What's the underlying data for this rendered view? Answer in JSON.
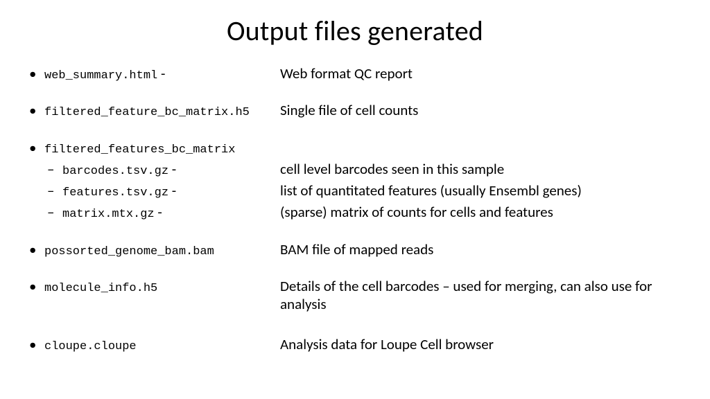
{
  "title": "Output files generated",
  "items": {
    "web_summary": {
      "file": "web_summary.html",
      "dash": "-",
      "desc": "Web format QC report"
    },
    "ffbm_h5": {
      "file": "filtered_feature_bc_matrix.h5",
      "desc": "Single file of cell counts"
    },
    "ffbm_dir": {
      "file": "filtered_features_bc_matrix"
    },
    "barcodes": {
      "file": "barcodes.tsv.gz",
      "dash": "-",
      "desc": "cell level barcodes seen in this sample"
    },
    "features": {
      "file": "features.tsv.gz",
      "dash": "-",
      "desc": "list of quantitated features (usually Ensembl genes)"
    },
    "matrix": {
      "file": "matrix.mtx.gz",
      "dash": "-",
      "desc": "(sparse) matrix of counts for cells and features"
    },
    "bam": {
      "file": "possorted_genome_bam.bam",
      "desc": "BAM file of mapped reads"
    },
    "molinfo": {
      "file": "molecule_info.h5",
      "desc": "Details of the cell barcodes – used for merging, can also use for analysis"
    },
    "cloupe": {
      "file": "cloupe.cloupe",
      "desc": "Analysis data for Loupe Cell browser"
    }
  },
  "bullets": {
    "top": "•",
    "sub": "–"
  }
}
